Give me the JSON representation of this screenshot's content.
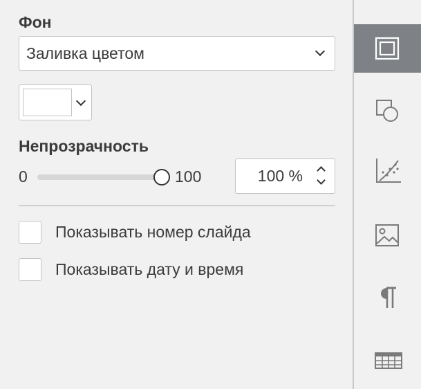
{
  "background": {
    "title": "Фон",
    "fill_type": "Заливка цветом",
    "fill_color": "#ffffff"
  },
  "opacity": {
    "title": "Непрозрачность",
    "min_label": "0",
    "max_label": "100",
    "value": 100,
    "value_text": "100 %"
  },
  "options": {
    "show_slide_number": {
      "label": "Показывать номер слайда",
      "checked": false
    },
    "show_date_time": {
      "label": "Показывать дату и время",
      "checked": false
    }
  },
  "rail": {
    "items": [
      {
        "icon": "slide-settings-icon",
        "active": true
      },
      {
        "icon": "shape-settings-icon",
        "active": false
      },
      {
        "icon": "chart-settings-icon",
        "active": false
      },
      {
        "icon": "image-settings-icon",
        "active": false
      },
      {
        "icon": "paragraph-settings-icon",
        "active": false
      },
      {
        "icon": "table-settings-icon",
        "active": false
      }
    ]
  },
  "colors": {
    "rail_active": "#7e8286",
    "icon_gray": "#7a7a7a",
    "panel_bg": "#f1f1f1"
  }
}
